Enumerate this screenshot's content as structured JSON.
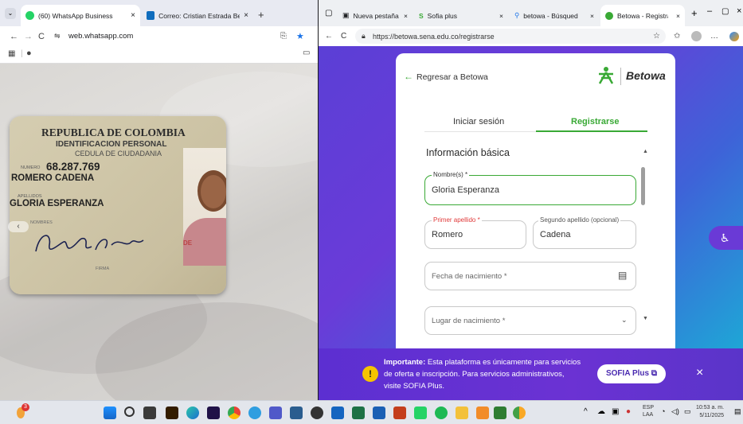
{
  "left_window": {
    "tabs": [
      {
        "label": "(60) WhatsApp Business",
        "close": "×"
      },
      {
        "label": "Correo: Cristian Estrada Betanc",
        "close": "×"
      }
    ],
    "new_tab": "+",
    "url": "web.whatsapp.com",
    "id_card": {
      "title": "REPUBLICA DE COLOMBIA",
      "subtitle": "IDENTIFICACION PERSONAL",
      "doc_type": "CEDULA DE CIUDADANIA",
      "number_label": "NUMERO",
      "number": "68.287.769",
      "surnames": "ROMERO CADENA",
      "surnames_label": "APELLIDOS",
      "names": "GLORIA ESPERANZA",
      "names_label": "NOMBRES",
      "signature_label": "FIRMA"
    }
  },
  "right_window": {
    "tabs": [
      {
        "label": "Nueva pestaña",
        "close": "×"
      },
      {
        "label": "Sofia plus",
        "close": "×"
      },
      {
        "label": "betowa - Búsqued",
        "close": "×"
      },
      {
        "label": "Betowa - Registra",
        "close": "×"
      }
    ],
    "new_tab": "+",
    "url": "https://betowa.sena.edu.co/registrarse",
    "back_link": "Regresar a Betowa",
    "brand": "Betowa",
    "tab_login": "Iniciar sesión",
    "tab_register": "Registrarse",
    "section_title": "Información básica",
    "fields": {
      "nombres": {
        "label": "Nombre(s) *",
        "value": "Gloria Esperanza"
      },
      "primer_apellido": {
        "label": "Primer apellido *",
        "value": "Romero"
      },
      "segundo_apellido": {
        "label": "Segundo apellido (opcional)",
        "value": "Cadena"
      },
      "fecha": {
        "placeholder": "Fecha de nacimiento *"
      },
      "lugar": {
        "placeholder": "Lugar de nacimiento *"
      }
    },
    "banner": {
      "bold": "Importante:",
      "text": "Esta plataforma es únicamente para servicios de oferta e inscripción. Para servicios administrativos, visite SOFIA Plus.",
      "button": "SOFIA Plus",
      "close": "×"
    }
  },
  "taskbar": {
    "weather_badge": "3",
    "lang": "ESP",
    "lang_sub": "LAA",
    "time": "10:53 a. m.",
    "date": "5/11/2025"
  },
  "colors": {
    "sena_green": "#39a935",
    "brand_purple": "#5b2fd0",
    "banner_yellow": "#f5c400"
  }
}
